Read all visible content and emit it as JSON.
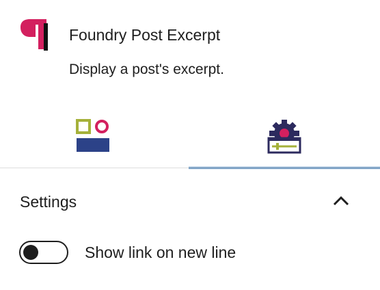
{
  "block": {
    "title": "Foundry Post Excerpt",
    "description": "Display a post's excerpt.",
    "icon": "paragraph-pilcrow-icon"
  },
  "tabs": [
    {
      "name": "styles",
      "icon": "shapes-icon",
      "active": false
    },
    {
      "name": "settings",
      "icon": "gear-sliders-icon",
      "active": true
    }
  ],
  "settings": {
    "title": "Settings",
    "expanded": true,
    "toggle": {
      "label": "Show link on new line",
      "checked": false
    }
  },
  "colors": {
    "accent": "#3a78b4",
    "brand_magenta": "#d3205f",
    "brand_navy": "#2c4288",
    "brand_green": "#a5b13a",
    "text": "#1e1e1e",
    "divider": "#dddddd"
  }
}
